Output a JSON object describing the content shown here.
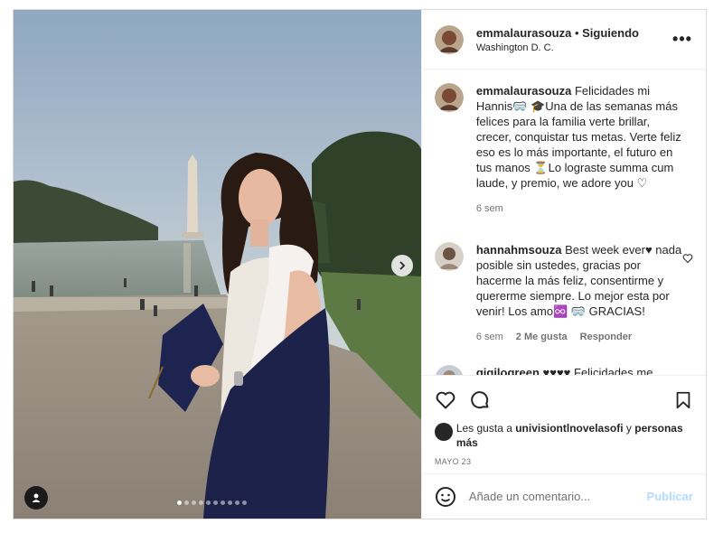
{
  "post": {
    "username": "emmalaurasouza",
    "separator": "•",
    "follow_label": "Siguiendo",
    "location": "Washington D. C.",
    "more_icon": "ellipsis-icon"
  },
  "media": {
    "carousel_count": 10,
    "active_index": 0
  },
  "comments": [
    {
      "username": "emmalaurasouza",
      "text": "Felicidades mi Hannis🥽 🎓Una de las semanas más felices para la familia verte brillar, crecer, conquistar tus metas. Verte feliz eso es lo más importante, el futuro en tus manos ⏳Lo lograste summa cum laude, y premio, we adore you ♡",
      "time": "6 sem"
    },
    {
      "username": "hannahmsouza",
      "text": "Best week ever♥ nada posible sin ustedes, gracias por hacerme la más feliz, consentirme y quererme siempre. Lo mejor esta por venir! Los amo♾️ 🥽 GRACIAS!",
      "time": "6 sem",
      "likes": "2 Me gusta",
      "reply": "Responder"
    },
    {
      "username": "gigilogreen",
      "text": "♥♥♥♥ Felicidades me",
      "time": ""
    }
  ],
  "likes": {
    "prefix": "Les gusta a",
    "user": "univisiontlnovelasofi",
    "middle": "y",
    "suffix": "personas más"
  },
  "date": "MAYO 23",
  "composer": {
    "placeholder": "Añade un comentario...",
    "post_label": "Publicar"
  }
}
